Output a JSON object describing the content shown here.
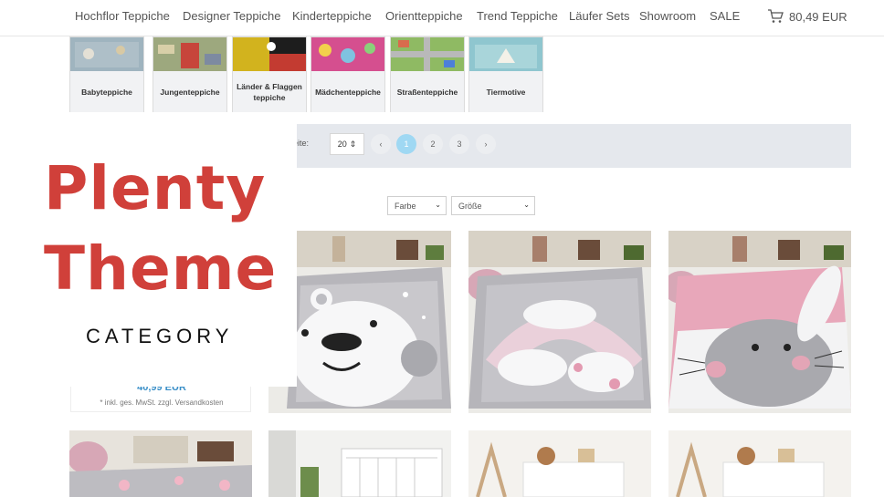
{
  "nav": {
    "items": [
      "Hochflor Teppiche",
      "Designer Teppiche",
      "Kinderteppiche",
      "Orientteppiche",
      "Trend Teppiche",
      "Läufer Sets",
      "Showroom",
      "SALE"
    ],
    "cart_total": "80,49 EUR",
    "cart_icon": "cart-icon"
  },
  "categories": [
    {
      "label": "Babyteppiche"
    },
    {
      "label": "Jungenteppiche"
    },
    {
      "label": "Länder & Flaggenteppiche"
    },
    {
      "label": "Mädchenteppiche"
    },
    {
      "label": "Straßenteppiche"
    },
    {
      "label": "Tiermotive"
    }
  ],
  "pagination": {
    "per_page_label": "eite:",
    "per_page_value": "20",
    "prev": "‹",
    "pages": [
      "1",
      "2",
      "3"
    ],
    "next": "›",
    "current": "1"
  },
  "filters": {
    "color": "Farbe",
    "size": "Größe"
  },
  "products": {
    "price": "40,99 EUR",
    "price_note": "* inkl. ges. MwSt. zzgl. Versandkosten"
  },
  "overlay": {
    "title_line1": "Plenty",
    "title_line2": "Theme",
    "subtitle": "CATEGORY"
  },
  "colors": {
    "accent_red": "#d0403a",
    "price_blue": "#3a8fc8",
    "page_active": "#9fd8f3",
    "pagebar_bg": "#e5e8ed"
  }
}
